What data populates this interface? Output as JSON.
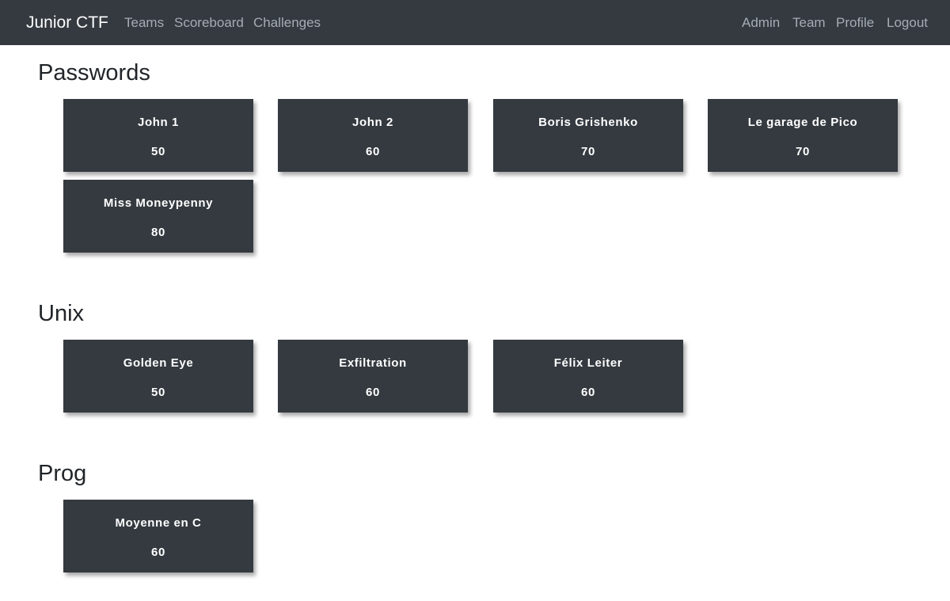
{
  "navbar": {
    "brand": "Junior CTF",
    "left_links": [
      "Teams",
      "Scoreboard",
      "Challenges"
    ],
    "right_links": [
      "Admin",
      "Team",
      "Profile",
      "Logout"
    ]
  },
  "sections": [
    {
      "title": "Passwords",
      "challenges": [
        {
          "name": "John 1",
          "points": "50"
        },
        {
          "name": "John 2",
          "points": "60"
        },
        {
          "name": "Boris Grishenko",
          "points": "70"
        },
        {
          "name": "Le garage de Pico",
          "points": "70"
        },
        {
          "name": "Miss Moneypenny",
          "points": "80"
        }
      ]
    },
    {
      "title": "Unix",
      "challenges": [
        {
          "name": "Golden Eye",
          "points": "50"
        },
        {
          "name": "Exfiltration",
          "points": "60"
        },
        {
          "name": "Félix Leiter",
          "points": "60"
        }
      ]
    },
    {
      "title": "Prog",
      "challenges": [
        {
          "name": "Moyenne en C",
          "points": "60"
        }
      ]
    }
  ]
}
